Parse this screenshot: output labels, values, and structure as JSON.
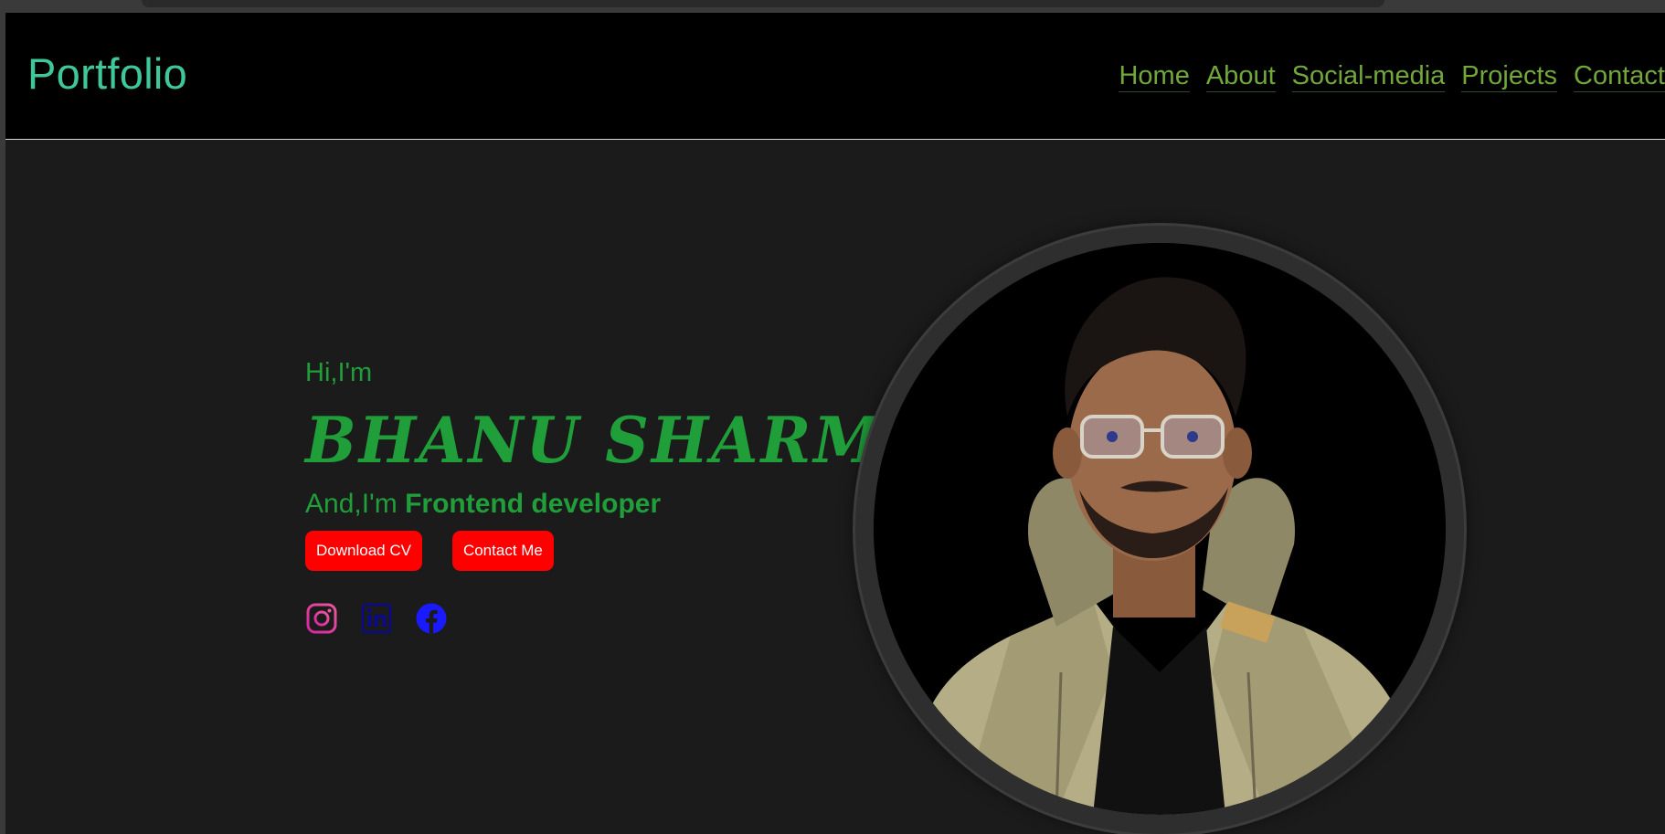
{
  "header": {
    "logo": "Portfolio",
    "nav": [
      "Home",
      "About",
      "Social-media",
      "Projects",
      "Contact"
    ]
  },
  "hero": {
    "greeting": "Hi,I'm",
    "name": "BHANU SHARMA",
    "role_prefix": "And,I'm ",
    "role_highlight": "Frontend developer",
    "download_cv": "Download CV",
    "contact_me": "Contact Me"
  },
  "socials": [
    "instagram-icon",
    "linkedin-icon",
    "facebook-icon"
  ],
  "colors": {
    "background": "#1c1b1b",
    "header": "#000000",
    "logo": "#3fc79a",
    "nav": "#72a83a",
    "accent_green": "#1f9e3a",
    "button": "#ff0000",
    "instagram": "#e1306c",
    "linkedin": "#0a0a8a",
    "facebook": "#1a1aff"
  }
}
